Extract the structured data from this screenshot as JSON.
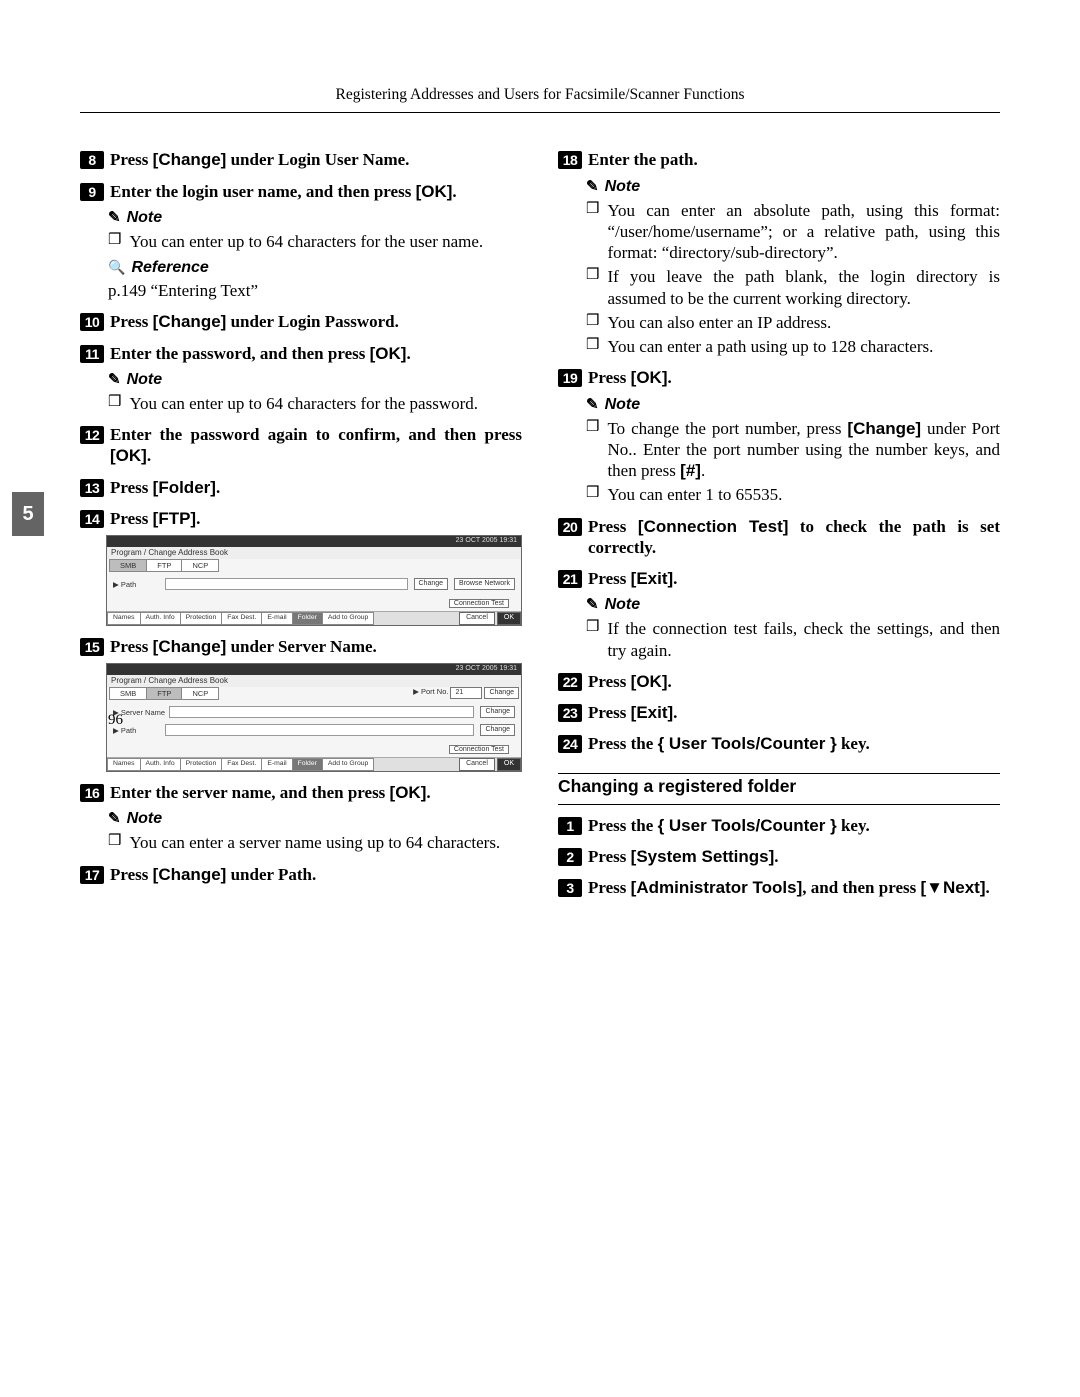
{
  "header": "Registering Addresses and Users for Facsimile/Scanner Functions",
  "chapter_tab": "5",
  "page_number": "96",
  "left": {
    "s8": {
      "num": "8",
      "pre": "Press ",
      "key": "[Change]",
      "post": " under Login User Name."
    },
    "s9": {
      "num": "9",
      "pre": "Enter the login user name, and then press ",
      "key": "[OK]",
      "post": "."
    },
    "note_heading_1": "Note",
    "note9_items": [
      "You can enter up to 64 characters for the user name."
    ],
    "ref_heading": "Reference",
    "ref_text": "p.149 “Entering Text”",
    "s10": {
      "num": "10",
      "pre": "Press ",
      "key": "[Change]",
      "post": " under Login Password."
    },
    "s11": {
      "num": "11",
      "pre": "Enter the password, and then press ",
      "key": "[OK]",
      "post": "."
    },
    "note_heading_2": "Note",
    "note11_items": [
      "You can enter up to 64 characters for the password."
    ],
    "s12": {
      "num": "12",
      "pre": "Enter the password again to confirm, and then press ",
      "key": "[OK]",
      "post": "."
    },
    "s13": {
      "num": "13",
      "pre": "Press ",
      "key": "[Folder]",
      "post": "."
    },
    "s14": {
      "num": "14",
      "pre": "Press ",
      "key": "[FTP]",
      "post": "."
    },
    "s15": {
      "num": "15",
      "pre": "Press ",
      "key": "[Change]",
      "post": " under Server Name."
    },
    "s16": {
      "num": "16",
      "pre": "Enter the server name, and then press ",
      "key": "[OK]",
      "post": "."
    },
    "note_heading_3": "Note",
    "note16_items": [
      "You can enter a server name using up to 64 characters."
    ],
    "s17": {
      "num": "17",
      "pre": "Press ",
      "key": "[Change]",
      "post": " under Path."
    }
  },
  "right": {
    "s18": {
      "num": "18",
      "text": "Enter the path."
    },
    "note_heading_a": "Note",
    "note18_items": [
      "You can enter an absolute path, using this format: “/user/home/username”; or a relative path, using this format: “directory/sub-directory”.",
      "If you leave the path blank, the login directory is assumed to be the current working directory.",
      "You can also enter an IP address.",
      "You can enter a path using up to 128 characters."
    ],
    "s19": {
      "num": "19",
      "pre": "Press ",
      "key": "[OK]",
      "post": "."
    },
    "note_heading_b": "Note",
    "note19_items": [
      {
        "pre": "To change the port number, press ",
        "key1": "[Change]",
        "mid": " under Port No.. Enter the port number using the number keys, and then press ",
        "key2": "[#]",
        "post": "."
      },
      {
        "pre": "You can enter 1 to 65535."
      }
    ],
    "s20": {
      "num": "20",
      "pre": "Press ",
      "key": "[Connection Test]",
      "post": " to check the path is set correctly."
    },
    "s21": {
      "num": "21",
      "pre": "Press ",
      "key": "[Exit]",
      "post": "."
    },
    "note_heading_c": "Note",
    "note21_items": [
      "If the connection test fails, check the settings, and then try again."
    ],
    "s22": {
      "num": "22",
      "pre": "Press ",
      "key": "[OK]",
      "post": "."
    },
    "s23": {
      "num": "23",
      "pre": "Press ",
      "key": "[Exit]",
      "post": "."
    },
    "s24": {
      "num": "24",
      "pre": "Press the ",
      "key": "{ User Tools/Counter }",
      "post": " key."
    },
    "subheading": "Changing a registered folder",
    "b1": {
      "num": "1",
      "pre": "Press the ",
      "key": "{ User Tools/Counter }",
      "post": " key."
    },
    "b2": {
      "num": "2",
      "pre": "Press ",
      "key": "[System Settings]",
      "post": "."
    },
    "b3": {
      "num": "3",
      "pre": "Press ",
      "key1": "[Administrator Tools]",
      "mid": ", and then press ",
      "key2": "[▼Next]",
      "post": "."
    }
  },
  "screen1": {
    "topbar": "23 OCT 2005 19:31",
    "title": "Program / Change Address Book",
    "tabs": [
      "SMB",
      "FTP",
      "NCP"
    ],
    "active_tab": "SMB",
    "path_label": "▶ Path",
    "btn_change": "Change",
    "btn_browse": "Browse Network",
    "btn_conntest": "Connection Test",
    "bottom_tabs": [
      "Names",
      "Auth. Info",
      "Protection",
      "Fax Dest.",
      "E-mail",
      "Folder",
      "Add to Group"
    ],
    "active_bottom": "Folder",
    "cancel": "Cancel",
    "ok": "OK"
  },
  "screen2": {
    "topbar": "23 OCT 2005 19:31",
    "title": "Program / Change Address Book",
    "tabs": [
      "SMB",
      "FTP",
      "NCP"
    ],
    "active_tab": "FTP",
    "port_label": "▶ Port No.",
    "port_value": "21",
    "btn_change_port": "Change",
    "server_label": "▶ Server Name",
    "btn_change_sn": "Change",
    "path_label": "▶ Path",
    "btn_change_path": "Change",
    "btn_conntest": "Connection Test",
    "bottom_tabs": [
      "Names",
      "Auth. Info",
      "Protection",
      "Fax Dest.",
      "E-mail",
      "Folder",
      "Add to Group"
    ],
    "active_bottom": "Folder",
    "cancel": "Cancel",
    "ok": "OK"
  }
}
